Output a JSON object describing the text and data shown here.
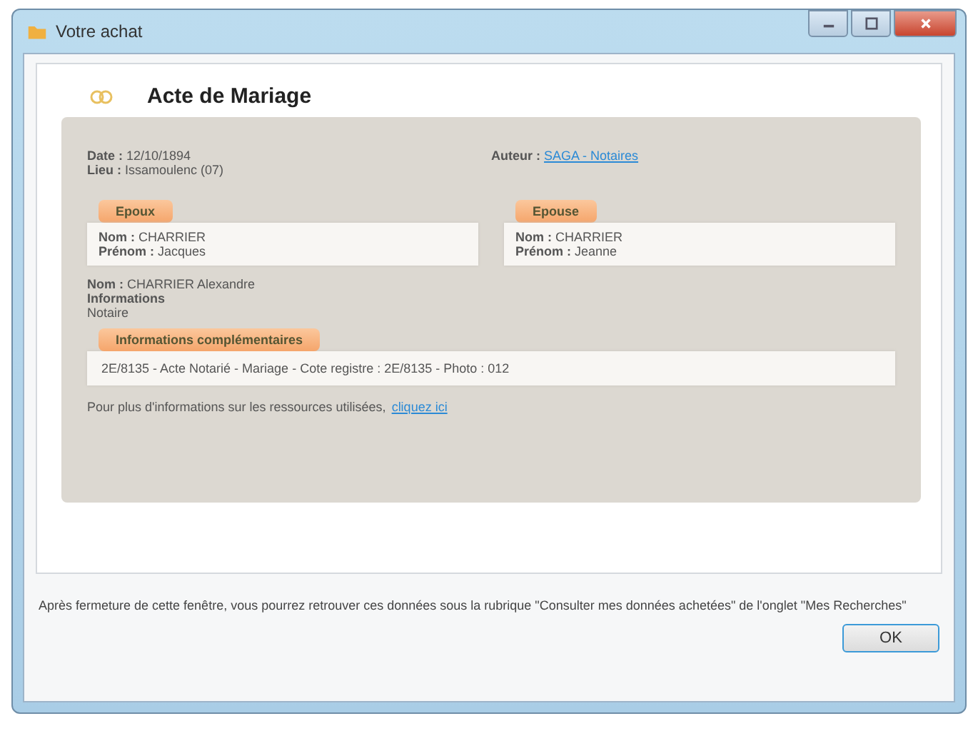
{
  "window": {
    "title": "Votre achat"
  },
  "act": {
    "title": "Acte de Mariage",
    "date": "**Date :** 12/10/1894",
    "place": "**Lieu :** Issamoulenc (07)",
    "author_label": "Auteur :",
    "author_link": "SAGA - Notaires",
    "persons": [
      {
        "heading": "Epoux",
        "name": "**Nom :** CHARRIER",
        "first_name": "**Prénom :** Jacques"
      },
      {
        "heading": "Epouse",
        "name": "**Nom :** CHARRIER",
        "first_name": "**Prénom :** Jeanne"
      }
    ],
    "extra_lines": [
      "**Nom :** CHARRIER Alexandre",
      "**Informations**",
      "Notaire"
    ],
    "more_heading": "Informations complémentaires",
    "more_text": "2E/8135 - Acte Notarié - Mariage - Cote registre : 2E/8135 - Photo : 012",
    "footer_text": "Pour plus d'informations sur les ressources utilisées,",
    "footer_link": "cliquez ici"
  },
  "notice": "Après fermeture de cette fenêtre, vous pourrez retrouver ces données sous la rubrique \"Consulter mes données achetées\" de l'onglet \"Mes Recherches\"",
  "buttons": [
    "OK"
  ]
}
